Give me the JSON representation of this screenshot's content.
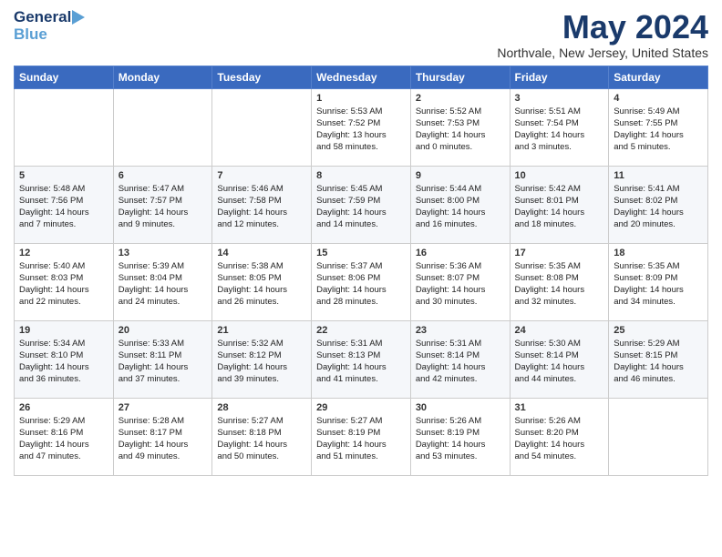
{
  "header": {
    "logo_general": "General",
    "logo_blue": "Blue",
    "month_year": "May 2024",
    "location": "Northvale, New Jersey, United States"
  },
  "days_of_week": [
    "Sunday",
    "Monday",
    "Tuesday",
    "Wednesday",
    "Thursday",
    "Friday",
    "Saturday"
  ],
  "weeks": [
    [
      {
        "day": "",
        "info": ""
      },
      {
        "day": "",
        "info": ""
      },
      {
        "day": "",
        "info": ""
      },
      {
        "day": "1",
        "info": "Sunrise: 5:53 AM\nSunset: 7:52 PM\nDaylight: 13 hours\nand 58 minutes."
      },
      {
        "day": "2",
        "info": "Sunrise: 5:52 AM\nSunset: 7:53 PM\nDaylight: 14 hours\nand 0 minutes."
      },
      {
        "day": "3",
        "info": "Sunrise: 5:51 AM\nSunset: 7:54 PM\nDaylight: 14 hours\nand 3 minutes."
      },
      {
        "day": "4",
        "info": "Sunrise: 5:49 AM\nSunset: 7:55 PM\nDaylight: 14 hours\nand 5 minutes."
      }
    ],
    [
      {
        "day": "5",
        "info": "Sunrise: 5:48 AM\nSunset: 7:56 PM\nDaylight: 14 hours\nand 7 minutes."
      },
      {
        "day": "6",
        "info": "Sunrise: 5:47 AM\nSunset: 7:57 PM\nDaylight: 14 hours\nand 9 minutes."
      },
      {
        "day": "7",
        "info": "Sunrise: 5:46 AM\nSunset: 7:58 PM\nDaylight: 14 hours\nand 12 minutes."
      },
      {
        "day": "8",
        "info": "Sunrise: 5:45 AM\nSunset: 7:59 PM\nDaylight: 14 hours\nand 14 minutes."
      },
      {
        "day": "9",
        "info": "Sunrise: 5:44 AM\nSunset: 8:00 PM\nDaylight: 14 hours\nand 16 minutes."
      },
      {
        "day": "10",
        "info": "Sunrise: 5:42 AM\nSunset: 8:01 PM\nDaylight: 14 hours\nand 18 minutes."
      },
      {
        "day": "11",
        "info": "Sunrise: 5:41 AM\nSunset: 8:02 PM\nDaylight: 14 hours\nand 20 minutes."
      }
    ],
    [
      {
        "day": "12",
        "info": "Sunrise: 5:40 AM\nSunset: 8:03 PM\nDaylight: 14 hours\nand 22 minutes."
      },
      {
        "day": "13",
        "info": "Sunrise: 5:39 AM\nSunset: 8:04 PM\nDaylight: 14 hours\nand 24 minutes."
      },
      {
        "day": "14",
        "info": "Sunrise: 5:38 AM\nSunset: 8:05 PM\nDaylight: 14 hours\nand 26 minutes."
      },
      {
        "day": "15",
        "info": "Sunrise: 5:37 AM\nSunset: 8:06 PM\nDaylight: 14 hours\nand 28 minutes."
      },
      {
        "day": "16",
        "info": "Sunrise: 5:36 AM\nSunset: 8:07 PM\nDaylight: 14 hours\nand 30 minutes."
      },
      {
        "day": "17",
        "info": "Sunrise: 5:35 AM\nSunset: 8:08 PM\nDaylight: 14 hours\nand 32 minutes."
      },
      {
        "day": "18",
        "info": "Sunrise: 5:35 AM\nSunset: 8:09 PM\nDaylight: 14 hours\nand 34 minutes."
      }
    ],
    [
      {
        "day": "19",
        "info": "Sunrise: 5:34 AM\nSunset: 8:10 PM\nDaylight: 14 hours\nand 36 minutes."
      },
      {
        "day": "20",
        "info": "Sunrise: 5:33 AM\nSunset: 8:11 PM\nDaylight: 14 hours\nand 37 minutes."
      },
      {
        "day": "21",
        "info": "Sunrise: 5:32 AM\nSunset: 8:12 PM\nDaylight: 14 hours\nand 39 minutes."
      },
      {
        "day": "22",
        "info": "Sunrise: 5:31 AM\nSunset: 8:13 PM\nDaylight: 14 hours\nand 41 minutes."
      },
      {
        "day": "23",
        "info": "Sunrise: 5:31 AM\nSunset: 8:14 PM\nDaylight: 14 hours\nand 42 minutes."
      },
      {
        "day": "24",
        "info": "Sunrise: 5:30 AM\nSunset: 8:14 PM\nDaylight: 14 hours\nand 44 minutes."
      },
      {
        "day": "25",
        "info": "Sunrise: 5:29 AM\nSunset: 8:15 PM\nDaylight: 14 hours\nand 46 minutes."
      }
    ],
    [
      {
        "day": "26",
        "info": "Sunrise: 5:29 AM\nSunset: 8:16 PM\nDaylight: 14 hours\nand 47 minutes."
      },
      {
        "day": "27",
        "info": "Sunrise: 5:28 AM\nSunset: 8:17 PM\nDaylight: 14 hours\nand 49 minutes."
      },
      {
        "day": "28",
        "info": "Sunrise: 5:27 AM\nSunset: 8:18 PM\nDaylight: 14 hours\nand 50 minutes."
      },
      {
        "day": "29",
        "info": "Sunrise: 5:27 AM\nSunset: 8:19 PM\nDaylight: 14 hours\nand 51 minutes."
      },
      {
        "day": "30",
        "info": "Sunrise: 5:26 AM\nSunset: 8:19 PM\nDaylight: 14 hours\nand 53 minutes."
      },
      {
        "day": "31",
        "info": "Sunrise: 5:26 AM\nSunset: 8:20 PM\nDaylight: 14 hours\nand 54 minutes."
      },
      {
        "day": "",
        "info": ""
      }
    ]
  ]
}
